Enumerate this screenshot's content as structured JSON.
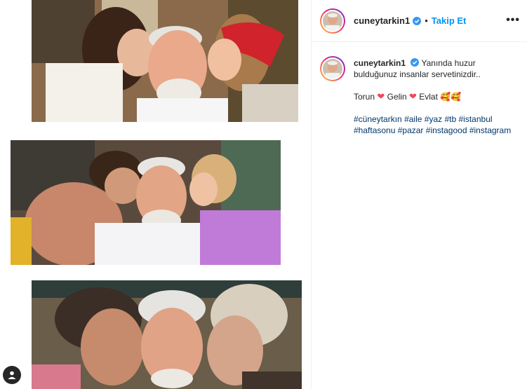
{
  "post": {
    "username": "cuneytarkin1",
    "follow_label": "Takip Et",
    "dot": "•",
    "more_label": "•••"
  },
  "caption": {
    "username": "cuneytarkin1",
    "text_line": "Yanında huzur bulduğunuz insanlar servetinizdir..",
    "family": {
      "torun": "Torun",
      "gelin": "Gelin",
      "evlat": "Evlat",
      "heart": "❤",
      "smile": "🥰🥰"
    },
    "hashtags": [
      "#cüneytarkın",
      "#aile",
      "#yaz",
      "#tb",
      "#istanbul",
      "#haftasonu",
      "#pazar",
      "#instagood",
      "#instagram"
    ]
  },
  "colors": {
    "link": "#0095f6",
    "hashtag": "#00376b",
    "heart": "#ed4956",
    "verified": "#3897f0"
  },
  "icons": {
    "verified": "verified-badge-icon",
    "more": "more-options-icon",
    "user": "user-icon"
  }
}
